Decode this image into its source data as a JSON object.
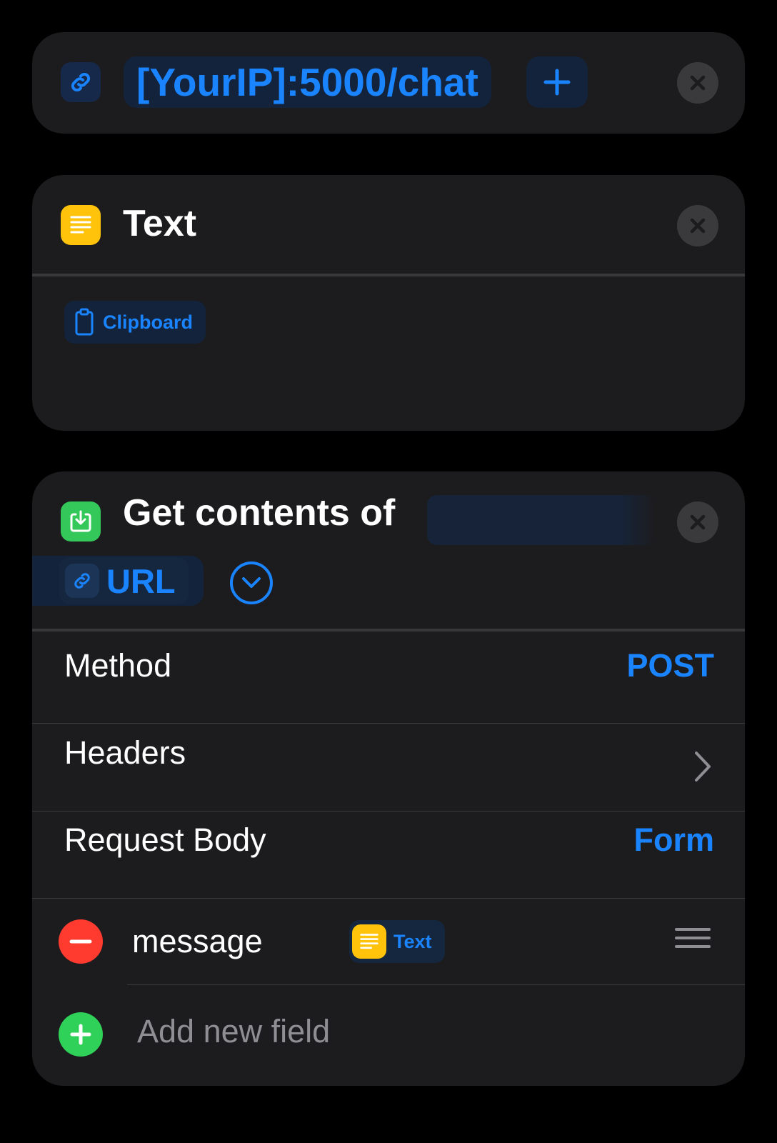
{
  "url_action": {
    "url_text": "[YourIP]:5000/chat",
    "icon": "link-icon",
    "add_icon": "plus-icon",
    "close_icon": "close-icon"
  },
  "text_action": {
    "title": "Text",
    "icon": "text-lines-icon",
    "variable_label": "Clipboard",
    "variable_icon": "clipboard-icon"
  },
  "get_contents_action": {
    "title": "Get contents of",
    "icon": "download-icon",
    "url_variable_label": "URL",
    "expand_icon": "chevron-down-circle-icon",
    "rows": {
      "method_label": "Method",
      "method_value": "POST",
      "headers_label": "Headers",
      "request_body_label": "Request Body",
      "request_body_value": "Form"
    },
    "fields": [
      {
        "key": "message",
        "value_label": "Text",
        "value_icon": "text-lines-icon"
      }
    ],
    "add_field_label": "Add new field"
  },
  "colors": {
    "background": "#000000",
    "card": "#1c1c1e",
    "accent": "#1a84ff",
    "text_icon_yellow": "#ffc30b",
    "download_green": "#34c759",
    "delete_red": "#ff3b30",
    "add_green": "#30d158"
  }
}
